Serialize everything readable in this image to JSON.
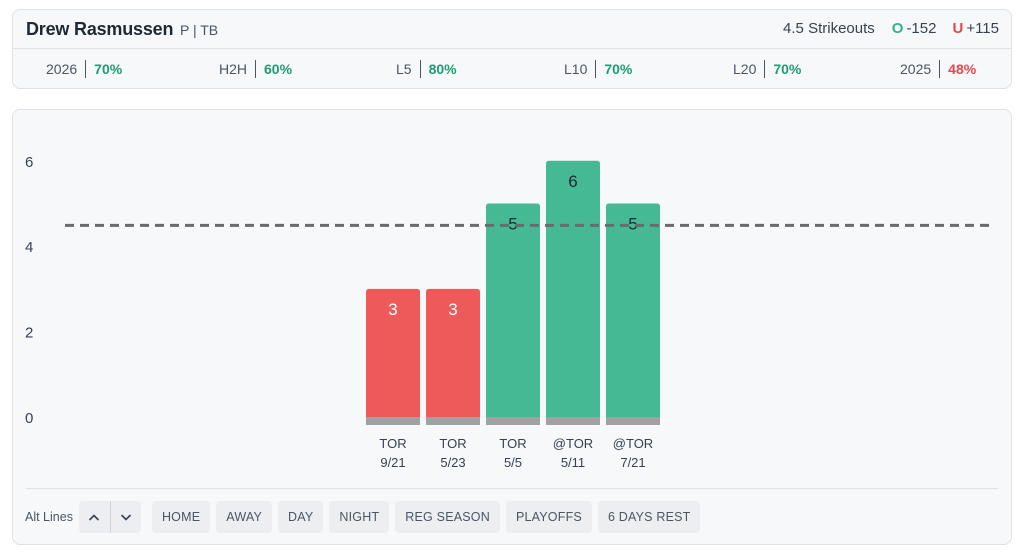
{
  "player": {
    "name": "Drew Rasmussen",
    "meta": "P | TB"
  },
  "line": {
    "prop": "4.5 Strikeouts",
    "over_label": "O",
    "over_odds": "-152",
    "under_label": "U",
    "under_odds": "+115"
  },
  "stats": [
    {
      "label": "2026",
      "value": "70%",
      "status": "good"
    },
    {
      "label": "H2H",
      "value": "60%",
      "status": "good"
    },
    {
      "label": "L5",
      "value": "80%",
      "status": "good"
    },
    {
      "label": "L10",
      "value": "70%",
      "status": "good"
    },
    {
      "label": "L20",
      "value": "70%",
      "status": "good"
    },
    {
      "label": "2025",
      "value": "48%",
      "status": "bad"
    }
  ],
  "chart_data": {
    "type": "bar",
    "categories": [
      "TOR 9/21",
      "TOR 5/23",
      "TOR 5/5",
      "@TOR 5/11",
      "@TOR 7/21"
    ],
    "opponents": [
      "TOR",
      "TOR",
      "TOR",
      "@TOR",
      "@TOR"
    ],
    "dates": [
      "9/21",
      "5/23",
      "5/5",
      "5/11",
      "7/21"
    ],
    "values": [
      3,
      3,
      5,
      6,
      5
    ],
    "line_value": 4.5,
    "yticks": [
      0,
      2,
      4,
      6
    ],
    "ylim": [
      0,
      6
    ],
    "colors": {
      "over": "#45b993",
      "under": "#ee5a5a",
      "base": "#a1a1a1",
      "line": "#6b6b6b"
    },
    "grid": false
  },
  "toolbar": {
    "alt_lines_label": "Alt Lines",
    "up_icon": "chevron-up-icon",
    "down_icon": "chevron-down-icon",
    "filters": [
      "HOME",
      "AWAY",
      "DAY",
      "NIGHT",
      "REG SEASON",
      "PLAYOFFS",
      "6 DAYS REST"
    ]
  }
}
